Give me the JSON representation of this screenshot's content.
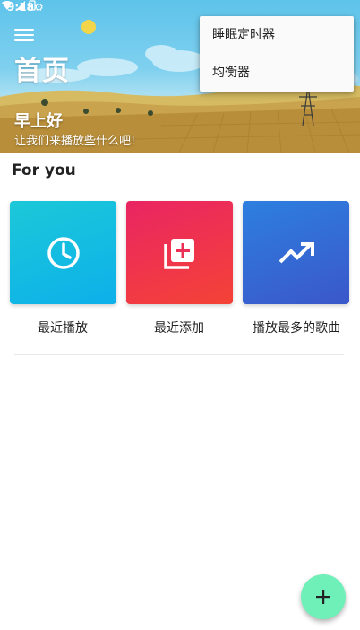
{
  "status_bar": {
    "time": "9:18"
  },
  "header": {
    "title": "首页",
    "greeting": "早上好",
    "subtitle": "让我们来播放些什么吧!"
  },
  "popup_menu": {
    "items": [
      {
        "label": "睡眠定时器"
      },
      {
        "label": "均衡器"
      }
    ]
  },
  "for_you": {
    "title": "For you",
    "cards": [
      {
        "label": "最近播放",
        "icon": "clock-icon",
        "color": "#0db0ea"
      },
      {
        "label": "最近添加",
        "icon": "add-to-library-icon",
        "color": "#f44336"
      },
      {
        "label": "播放最多的歌曲",
        "icon": "trending-up-icon",
        "color": "#3b57c9"
      }
    ]
  },
  "fab": {
    "icon": "plus-icon",
    "color": "#6ef0b8"
  }
}
